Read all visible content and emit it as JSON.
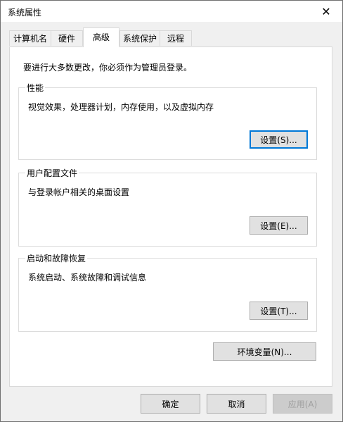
{
  "window": {
    "title": "系统属性",
    "close_glyph": "✕"
  },
  "tabs": [
    {
      "label": "计算机名"
    },
    {
      "label": "硬件"
    },
    {
      "label": "高级"
    },
    {
      "label": "系统保护"
    },
    {
      "label": "远程"
    }
  ],
  "active_tab": "高级",
  "admin_note": "要进行大多数更改，你必须作为管理员登录。",
  "groups": {
    "performance": {
      "title": "性能",
      "desc": "视觉效果，处理器计划，内存使用，以及虚拟内存",
      "button": "设置(S)..."
    },
    "user_profiles": {
      "title": "用户配置文件",
      "desc": "与登录帐户相关的桌面设置",
      "button": "设置(E)..."
    },
    "startup": {
      "title": "启动和故障恢复",
      "desc": "系统启动、系统故障和调试信息",
      "button": "设置(T)..."
    }
  },
  "env_button": "环境变量(N)...",
  "footer": {
    "ok": "确定",
    "cancel": "取消",
    "apply": "应用(A)"
  },
  "colors": {
    "focus_border": "#0078d7",
    "button_face": "#e1e1e1",
    "disabled_text": "#a0a0a0"
  },
  "icons": {
    "close": "close-icon"
  }
}
